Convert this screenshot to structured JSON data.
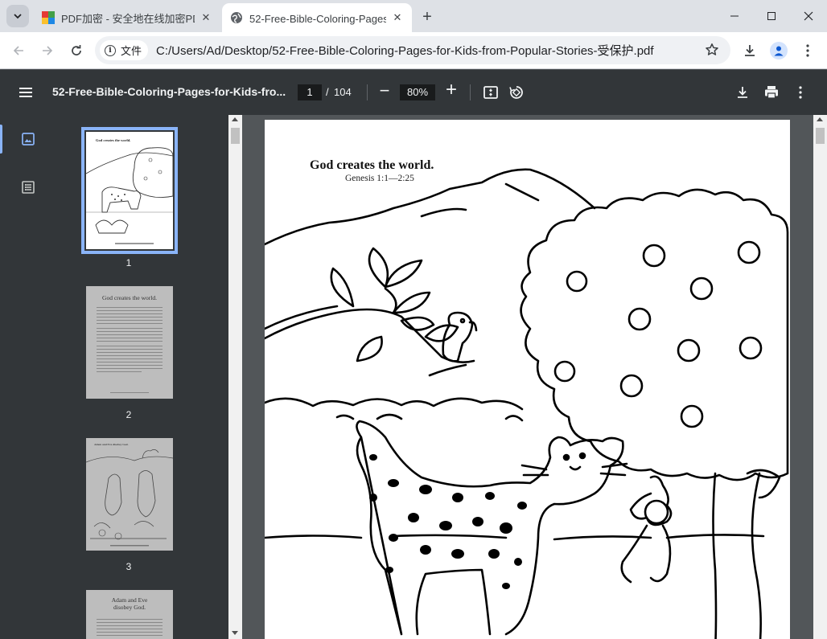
{
  "browser": {
    "tabs": [
      {
        "label": "PDF加密 - 安全地在线加密PDF",
        "active": false
      },
      {
        "label": "52-Free-Bible-Coloring-Pages-for-Kids-from-Popular-Stories-受保护.pdf",
        "active": true
      }
    ],
    "new_tab_icon": "plus-icon",
    "address": {
      "chip_label": "文件",
      "url": "C:/Users/Ad/Desktop/52-Free-Bible-Coloring-Pages-for-Kids-from-Popular-Stories-受保护.pdf"
    }
  },
  "pdf_viewer": {
    "title": "52-Free-Bible-Coloring-Pages-for-Kids-fro...",
    "current_page": "1",
    "page_separator": "/",
    "total_pages": "104",
    "zoom": "80%",
    "zoom_minus": "−",
    "zoom_plus": "+"
  },
  "sidebar": {
    "thumbnails": [
      {
        "number": "1",
        "title": "God creates the world."
      },
      {
        "number": "2",
        "title": "God creates the world."
      },
      {
        "number": "3",
        "title": "Adam and Eve disobey God."
      },
      {
        "number": "",
        "title": "Adam and Eve disobey God."
      }
    ]
  },
  "document": {
    "page_title": "God creates the world.",
    "page_reference": "Genesis 1:1—2:25"
  },
  "colors": {
    "pdf_toolbar": "#323639",
    "viewer_bg": "#525659",
    "accent": "#8ab4f8"
  }
}
